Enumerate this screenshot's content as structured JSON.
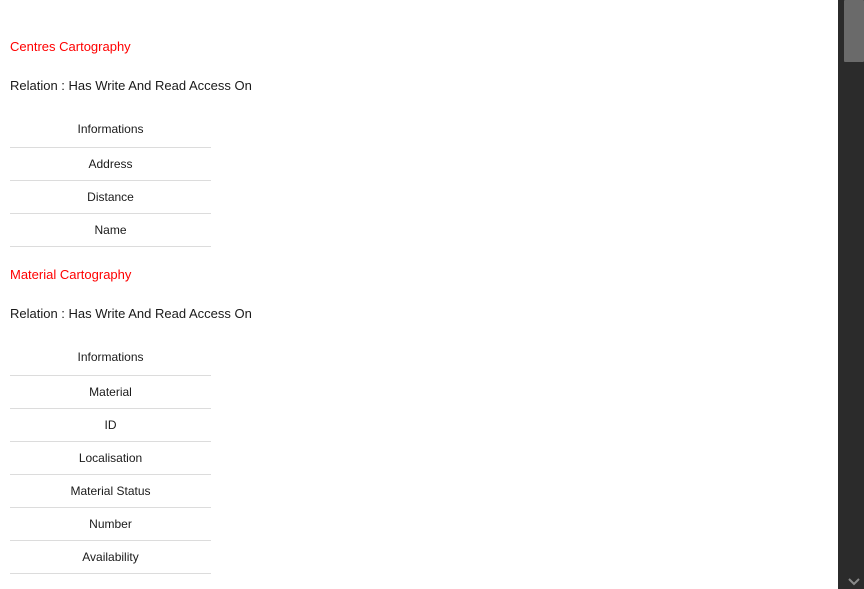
{
  "sections": [
    {
      "title": "Centres Cartography",
      "relation": "Relation : Has Write And Read Access On",
      "table_header": "Informations",
      "rows": [
        "Address",
        "Distance",
        "Name"
      ]
    },
    {
      "title": "Material Cartography",
      "relation": "Relation : Has Write And Read Access On",
      "table_header": "Informations",
      "rows": [
        "Material",
        "ID",
        "Localisation",
        "Material Status",
        "Number",
        "Availability"
      ]
    }
  ],
  "scrollbar": {
    "icon": "chevron-down-icon"
  },
  "colors": {
    "section_title": "#ff0000",
    "text": "#1a1a1a",
    "panel": "#2b2b2b",
    "scroll_thumb": "#6a6a6a"
  }
}
